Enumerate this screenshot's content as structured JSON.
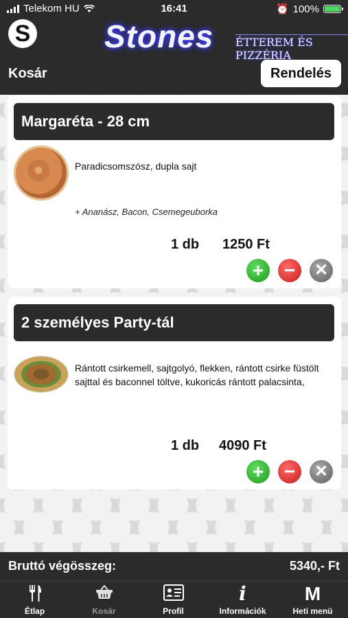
{
  "status_bar": {
    "carrier": "Telekom HU",
    "time": "16:41",
    "battery": "100%"
  },
  "header": {
    "logo_letter": "S",
    "brand": "Stones",
    "brand_sub": "ÉTTEREM ÉS PIZZÉRIA",
    "page_title": "Kosár",
    "order_button": "Rendelés"
  },
  "cart_items": [
    {
      "title": "Margaréta - 28 cm",
      "description": "Paradicsomszósz, dupla sajt",
      "extras": "+ Ananász, Bacon, Csemegeuborka",
      "quantity": "1 db",
      "price": "1250 Ft",
      "image_icon": "pizza-image"
    },
    {
      "title": "2 személyes Party-tál",
      "description": "Rántott csirkemell, sajtgolyó, flekken, rántott csirke füstölt sajttal és baconnel töltve, kukoricás rántott palacsinta,",
      "extras": "",
      "quantity": "1 db",
      "price": "4090 Ft",
      "image_icon": "platter-image"
    }
  ],
  "total": {
    "label": "Bruttó végösszeg:",
    "value": "5340,- Ft"
  },
  "tabs": [
    {
      "label": "Étlap",
      "icon": "fork-knife-icon",
      "glyph": "🍴"
    },
    {
      "label": "Kosár",
      "icon": "basket-icon",
      "glyph": "🧺"
    },
    {
      "label": "Profil",
      "icon": "id-card-icon",
      "glyph": "▤"
    },
    {
      "label": "Információk",
      "icon": "info-icon",
      "glyph": "i"
    },
    {
      "label": "Heti menü",
      "icon": "m-icon",
      "glyph": "M"
    }
  ],
  "colors": {
    "bar": "#2b2b2b",
    "add": "#2aa52a",
    "remove": "#d42a2a",
    "delete": "#6f6f6f"
  }
}
